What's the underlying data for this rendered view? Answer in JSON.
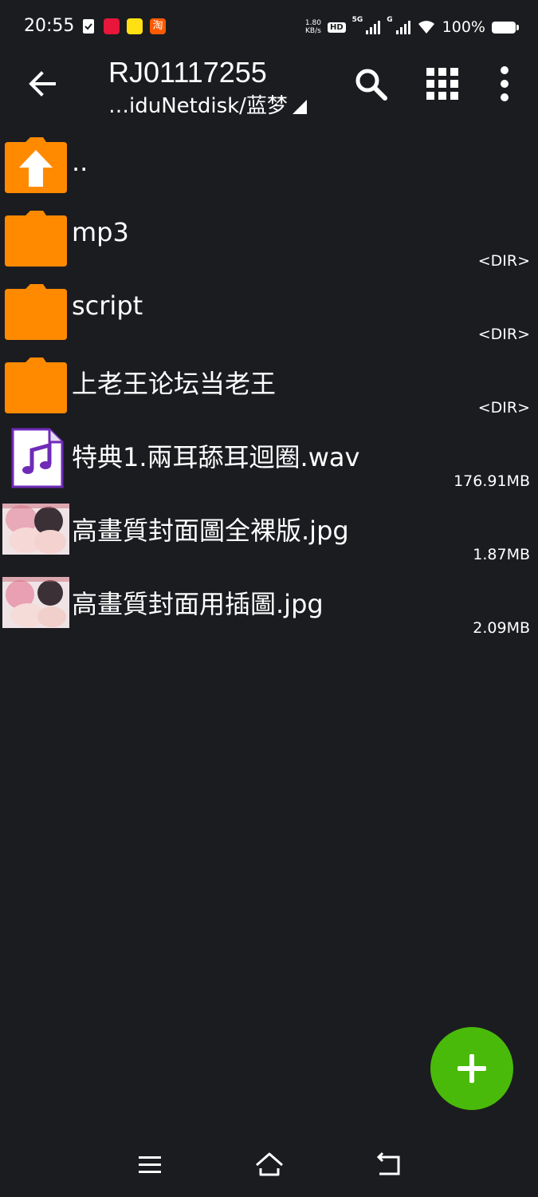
{
  "status_bar": {
    "time": "20:55",
    "net_speed_value": "1.80",
    "net_speed_unit": "KB/s",
    "hd_label": "HD",
    "net_type_1": "5G",
    "net_type_2": "G",
    "battery_text": "100%",
    "app_icons": [
      "todo-icon",
      "red-app-icon",
      "yellow-app-icon",
      "taobao-icon"
    ]
  },
  "toolbar": {
    "title": "RJ01117255",
    "subtitle": "…iduNetdisk/蓝梦",
    "icons": [
      "back-arrow-icon",
      "search-icon",
      "grid-view-icon",
      "more-vert-icon"
    ]
  },
  "files": [
    {
      "name": "..",
      "meta": "",
      "icon": "folder-up-icon"
    },
    {
      "name": "mp3",
      "meta": "<DIR>",
      "icon": "folder-icon"
    },
    {
      "name": "script",
      "meta": "<DIR>",
      "icon": "folder-icon"
    },
    {
      "name": "上老王论坛当老王",
      "meta": "<DIR>",
      "icon": "folder-icon"
    },
    {
      "name": "特典1.兩耳舔耳迴圈.wav",
      "meta": "176.91MB",
      "icon": "audio-file-icon"
    },
    {
      "name": "高畫質封面圖全裸版.jpg",
      "meta": "1.87MB",
      "icon": "image-thumbnail"
    },
    {
      "name": "高畫質封面用插圖.jpg",
      "meta": "2.09MB",
      "icon": "image-thumbnail"
    }
  ],
  "fab": {
    "icon": "plus-icon"
  },
  "nav_bar": {
    "icons": [
      "menu-icon",
      "home-icon",
      "back-icon"
    ]
  },
  "colors": {
    "background": "#1b1c20",
    "folder": "#ff8a00",
    "audio_icon": "#6f2bb8",
    "fab": "#4aba0a"
  }
}
